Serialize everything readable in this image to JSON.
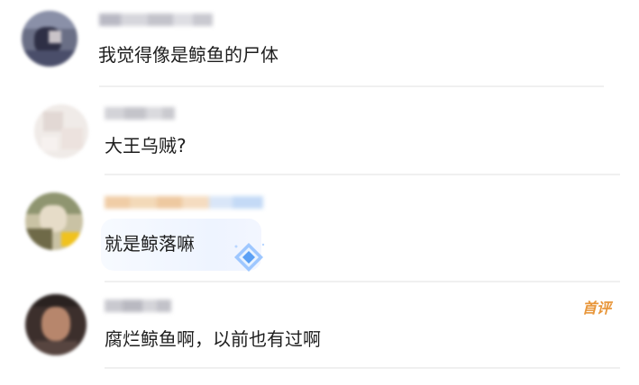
{
  "comments": [
    {
      "text": "我觉得像是鲸鱼的尸体"
    },
    {
      "text": "大王乌贼?"
    },
    {
      "text": "就是鲸落嘛"
    },
    {
      "text": "腐烂鲸鱼啊，以前也有过啊",
      "badge": "首评"
    }
  ],
  "colors": {
    "badge": "#e8963a",
    "divider": "#f0f0f0",
    "text": "#1e1e1e"
  },
  "icons": [
    "avatar",
    "blurred-username",
    "diamond-sticker-icon"
  ]
}
